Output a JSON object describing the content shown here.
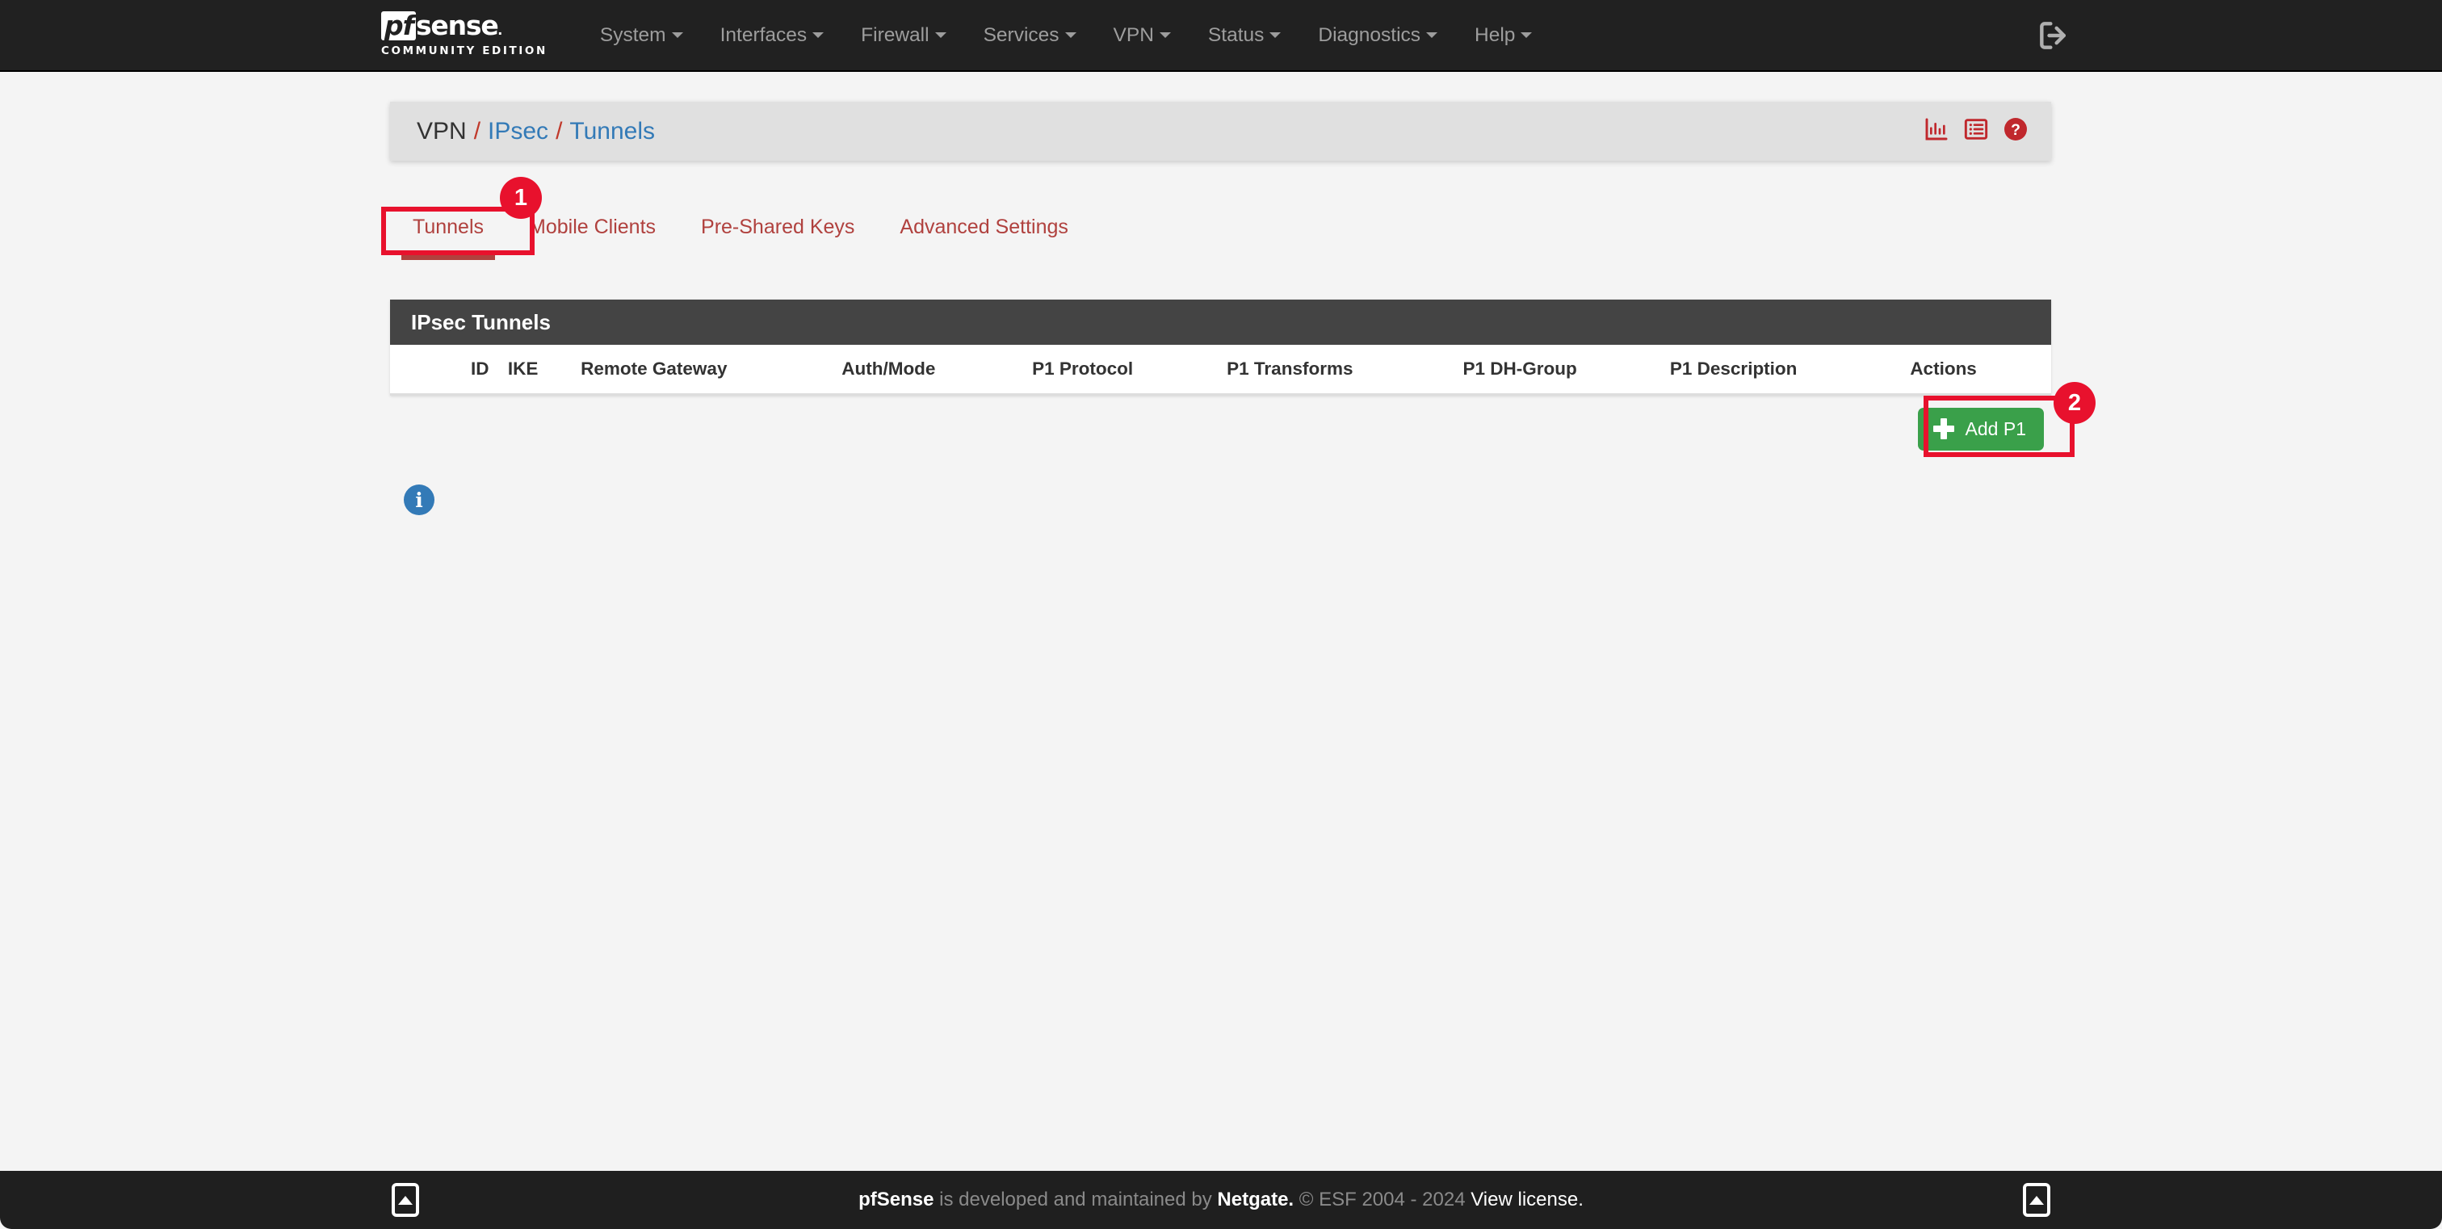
{
  "navbar": {
    "brand": {
      "pf": "pf",
      "sense": "sense",
      "edition": "COMMUNITY EDITION"
    },
    "items": [
      {
        "label": "System",
        "icon": "chevron-down-icon"
      },
      {
        "label": "Interfaces",
        "icon": "chevron-down-icon"
      },
      {
        "label": "Firewall",
        "icon": "chevron-down-icon"
      },
      {
        "label": "Services",
        "icon": "chevron-down-icon"
      },
      {
        "label": "VPN",
        "icon": "chevron-down-icon"
      },
      {
        "label": "Status",
        "icon": "chevron-down-icon"
      },
      {
        "label": "Diagnostics",
        "icon": "chevron-down-icon"
      },
      {
        "label": "Help",
        "icon": "chevron-down-icon"
      }
    ],
    "logout_icon": "logout-icon"
  },
  "breadcrumb": {
    "root": "VPN",
    "sep": "/",
    "section": "IPsec",
    "page": "Tunnels",
    "icons": [
      "chart-icon",
      "log-icon",
      "help-icon"
    ]
  },
  "tabs": [
    {
      "label": "Tunnels",
      "active": true
    },
    {
      "label": "Mobile Clients",
      "active": false
    },
    {
      "label": "Pre-Shared Keys",
      "active": false
    },
    {
      "label": "Advanced Settings",
      "active": false
    }
  ],
  "panel": {
    "title": "IPsec Tunnels",
    "columns": [
      "ID",
      "IKE",
      "Remote Gateway",
      "Auth/Mode",
      "P1 Protocol",
      "P1 Transforms",
      "P1 DH-Group",
      "P1 Description",
      "Actions"
    ],
    "rows": []
  },
  "actions": {
    "add_p1_label": "Add P1",
    "add_p1_icon": "plus-icon",
    "add_p1_color": "#3aa04a"
  },
  "info": {
    "icon": "info-icon",
    "glyph": "i"
  },
  "footer": {
    "brand": "pfSense",
    "middle": " is developed and maintained by ",
    "company": "Netgate.",
    "copyright": " © ESF 2004 - 2024 ",
    "license": "View license.",
    "scroll_top_icon": "scroll-to-top-icon"
  },
  "annotations": [
    {
      "number": "1",
      "target": "tab-tunnels",
      "color": "#e8112d"
    },
    {
      "number": "2",
      "target": "add-p1-button",
      "color": "#e8112d"
    }
  ]
}
